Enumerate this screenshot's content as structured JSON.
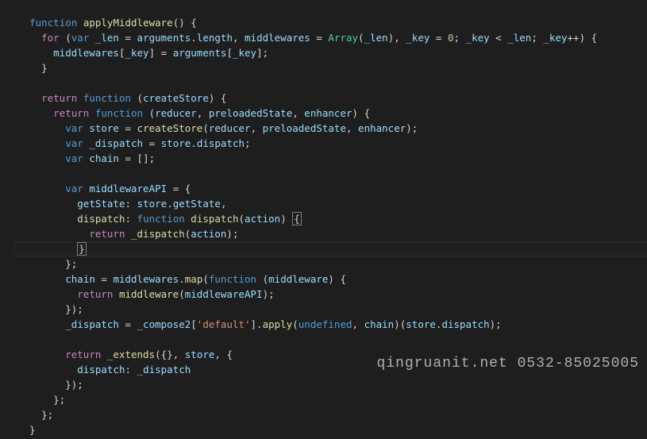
{
  "editor": {
    "highlighted_line_index": 16,
    "watermark": "qingruanit.net 0532-85025005",
    "lines": [
      [
        [
          "c-comm",
          "  "
        ],
        [
          "c-comm",
          ""
        ]
      ],
      [
        [
          "c-def",
          "  "
        ],
        [
          "c-blue",
          "function"
        ],
        [
          "c-def",
          " "
        ],
        [
          "c-fn",
          "applyMiddleware"
        ],
        [
          "c-def",
          "() {"
        ]
      ],
      [
        [
          "c-def",
          "    "
        ],
        [
          "c-kw",
          "for"
        ],
        [
          "c-def",
          " ("
        ],
        [
          "c-blue",
          "var"
        ],
        [
          "c-def",
          " "
        ],
        [
          "c-var",
          "_len"
        ],
        [
          "c-def",
          " = "
        ],
        [
          "c-var",
          "arguments"
        ],
        [
          "c-def",
          "."
        ],
        [
          "c-var",
          "length"
        ],
        [
          "c-def",
          ", "
        ],
        [
          "c-var",
          "middlewares"
        ],
        [
          "c-def",
          " = "
        ],
        [
          "c-type",
          "Array"
        ],
        [
          "c-def",
          "("
        ],
        [
          "c-var",
          "_len"
        ],
        [
          "c-def",
          "), "
        ],
        [
          "c-var",
          "_key"
        ],
        [
          "c-def",
          " = "
        ],
        [
          "c-num",
          "0"
        ],
        [
          "c-def",
          "; "
        ],
        [
          "c-var",
          "_key"
        ],
        [
          "c-def",
          " < "
        ],
        [
          "c-var",
          "_len"
        ],
        [
          "c-def",
          "; "
        ],
        [
          "c-var",
          "_key"
        ],
        [
          "c-def",
          "++) {"
        ]
      ],
      [
        [
          "c-def",
          "      "
        ],
        [
          "c-var",
          "middlewares"
        ],
        [
          "c-def",
          "["
        ],
        [
          "c-var",
          "_key"
        ],
        [
          "c-def",
          "] = "
        ],
        [
          "c-var",
          "arguments"
        ],
        [
          "c-def",
          "["
        ],
        [
          "c-var",
          "_key"
        ],
        [
          "c-def",
          "];"
        ]
      ],
      [
        [
          "c-def",
          "    }"
        ]
      ],
      [
        [
          "c-def",
          ""
        ]
      ],
      [
        [
          "c-def",
          "    "
        ],
        [
          "c-kw",
          "return"
        ],
        [
          "c-def",
          " "
        ],
        [
          "c-blue",
          "function"
        ],
        [
          "c-def",
          " ("
        ],
        [
          "c-var",
          "createStore"
        ],
        [
          "c-def",
          ") {"
        ]
      ],
      [
        [
          "c-def",
          "      "
        ],
        [
          "c-kw",
          "return"
        ],
        [
          "c-def",
          " "
        ],
        [
          "c-blue",
          "function"
        ],
        [
          "c-def",
          " ("
        ],
        [
          "c-var",
          "reducer"
        ],
        [
          "c-def",
          ", "
        ],
        [
          "c-var",
          "preloadedState"
        ],
        [
          "c-def",
          ", "
        ],
        [
          "c-var",
          "enhancer"
        ],
        [
          "c-def",
          ") {"
        ]
      ],
      [
        [
          "c-def",
          "        "
        ],
        [
          "c-blue",
          "var"
        ],
        [
          "c-def",
          " "
        ],
        [
          "c-var",
          "store"
        ],
        [
          "c-def",
          " = "
        ],
        [
          "c-fn",
          "createStore"
        ],
        [
          "c-def",
          "("
        ],
        [
          "c-var",
          "reducer"
        ],
        [
          "c-def",
          ", "
        ],
        [
          "c-var",
          "preloadedState"
        ],
        [
          "c-def",
          ", "
        ],
        [
          "c-var",
          "enhancer"
        ],
        [
          "c-def",
          ");"
        ]
      ],
      [
        [
          "c-def",
          "        "
        ],
        [
          "c-blue",
          "var"
        ],
        [
          "c-def",
          " "
        ],
        [
          "c-var",
          "_dispatch"
        ],
        [
          "c-def",
          " = "
        ],
        [
          "c-var",
          "store"
        ],
        [
          "c-def",
          "."
        ],
        [
          "c-var",
          "dispatch"
        ],
        [
          "c-def",
          ";"
        ]
      ],
      [
        [
          "c-def",
          "        "
        ],
        [
          "c-blue",
          "var"
        ],
        [
          "c-def",
          " "
        ],
        [
          "c-var",
          "chain"
        ],
        [
          "c-def",
          " = [];"
        ]
      ],
      [
        [
          "c-def",
          ""
        ]
      ],
      [
        [
          "c-def",
          "        "
        ],
        [
          "c-blue",
          "var"
        ],
        [
          "c-def",
          " "
        ],
        [
          "c-var",
          "middlewareAPI"
        ],
        [
          "c-def",
          " = {"
        ]
      ],
      [
        [
          "c-def",
          "          "
        ],
        [
          "c-var",
          "getState"
        ],
        [
          "c-def",
          ": "
        ],
        [
          "c-var",
          "store"
        ],
        [
          "c-def",
          "."
        ],
        [
          "c-var",
          "getState"
        ],
        [
          "c-def",
          ","
        ]
      ],
      [
        [
          "c-def",
          "          "
        ],
        [
          "c-fn",
          "dispatch"
        ],
        [
          "c-def",
          ": "
        ],
        [
          "c-blue",
          "function"
        ],
        [
          "c-def",
          " "
        ],
        [
          "c-fn",
          "dispatch"
        ],
        [
          "c-def",
          "("
        ],
        [
          "c-var",
          "action"
        ],
        [
          "c-def",
          ") "
        ],
        [
          "cursor",
          "{"
        ]
      ],
      [
        [
          "c-def",
          "            "
        ],
        [
          "c-kw",
          "return"
        ],
        [
          "c-def",
          " "
        ],
        [
          "c-fn",
          "_dispatch"
        ],
        [
          "c-def",
          "("
        ],
        [
          "c-var",
          "action"
        ],
        [
          "c-def",
          ");"
        ]
      ],
      [
        [
          "c-def",
          "          "
        ],
        [
          "cursor",
          "}"
        ]
      ],
      [
        [
          "c-def",
          "        };"
        ]
      ],
      [
        [
          "c-def",
          "        "
        ],
        [
          "c-var",
          "chain"
        ],
        [
          "c-def",
          " = "
        ],
        [
          "c-var",
          "middlewares"
        ],
        [
          "c-def",
          "."
        ],
        [
          "c-fn",
          "map"
        ],
        [
          "c-def",
          "("
        ],
        [
          "c-blue",
          "function"
        ],
        [
          "c-def",
          " ("
        ],
        [
          "c-var",
          "middleware"
        ],
        [
          "c-def",
          ") {"
        ]
      ],
      [
        [
          "c-def",
          "          "
        ],
        [
          "c-kw",
          "return"
        ],
        [
          "c-def",
          " "
        ],
        [
          "c-fn",
          "middleware"
        ],
        [
          "c-def",
          "("
        ],
        [
          "c-var",
          "middlewareAPI"
        ],
        [
          "c-def",
          ");"
        ]
      ],
      [
        [
          "c-def",
          "        });"
        ]
      ],
      [
        [
          "c-def",
          "        "
        ],
        [
          "c-var",
          "_dispatch"
        ],
        [
          "c-def",
          " = "
        ],
        [
          "c-var",
          "_compose2"
        ],
        [
          "c-def",
          "["
        ],
        [
          "c-str",
          "'default'"
        ],
        [
          "c-def",
          "]."
        ],
        [
          "c-fn",
          "apply"
        ],
        [
          "c-def",
          "("
        ],
        [
          "c-blue",
          "undefined"
        ],
        [
          "c-def",
          ", "
        ],
        [
          "c-var",
          "chain"
        ],
        [
          "c-def",
          ")("
        ],
        [
          "c-var",
          "store"
        ],
        [
          "c-def",
          "."
        ],
        [
          "c-var",
          "dispatch"
        ],
        [
          "c-def",
          ");"
        ]
      ],
      [
        [
          "c-def",
          ""
        ]
      ],
      [
        [
          "c-def",
          "        "
        ],
        [
          "c-kw",
          "return"
        ],
        [
          "c-def",
          " "
        ],
        [
          "c-fn",
          "_extends"
        ],
        [
          "c-def",
          "({}, "
        ],
        [
          "c-var",
          "store"
        ],
        [
          "c-def",
          ", {"
        ]
      ],
      [
        [
          "c-def",
          "          "
        ],
        [
          "c-var",
          "dispatch"
        ],
        [
          "c-def",
          ": "
        ],
        [
          "c-var",
          "_dispatch"
        ]
      ],
      [
        [
          "c-def",
          "        });"
        ]
      ],
      [
        [
          "c-def",
          "      };"
        ]
      ],
      [
        [
          "c-def",
          "    };"
        ]
      ],
      [
        [
          "c-def",
          "  }"
        ]
      ]
    ]
  }
}
